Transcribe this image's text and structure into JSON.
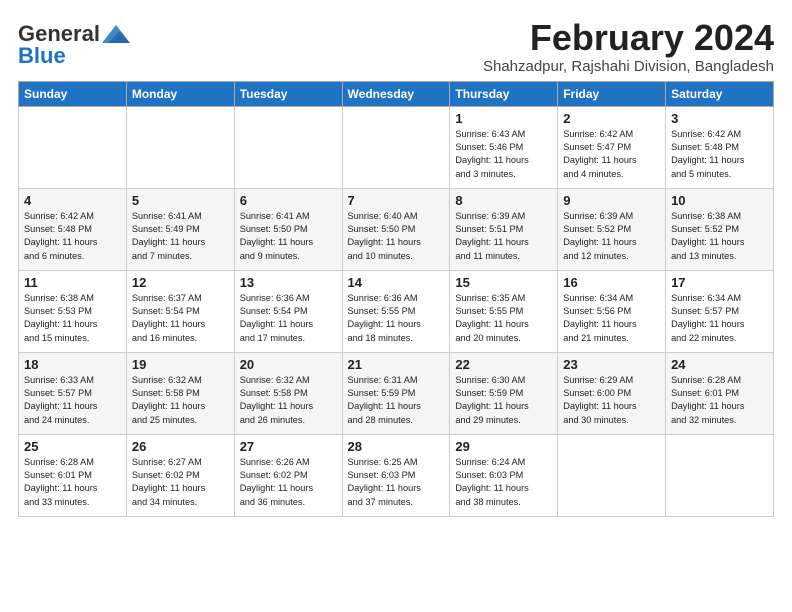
{
  "logo": {
    "line1": "General",
    "line2": "Blue"
  },
  "title": "February 2024",
  "location": "Shahzadpur, Rajshahi Division, Bangladesh",
  "weekdays": [
    "Sunday",
    "Monday",
    "Tuesday",
    "Wednesday",
    "Thursday",
    "Friday",
    "Saturday"
  ],
  "weeks": [
    [
      {
        "day": "",
        "info": ""
      },
      {
        "day": "",
        "info": ""
      },
      {
        "day": "",
        "info": ""
      },
      {
        "day": "",
        "info": ""
      },
      {
        "day": "1",
        "info": "Sunrise: 6:43 AM\nSunset: 5:46 PM\nDaylight: 11 hours\nand 3 minutes."
      },
      {
        "day": "2",
        "info": "Sunrise: 6:42 AM\nSunset: 5:47 PM\nDaylight: 11 hours\nand 4 minutes."
      },
      {
        "day": "3",
        "info": "Sunrise: 6:42 AM\nSunset: 5:48 PM\nDaylight: 11 hours\nand 5 minutes."
      }
    ],
    [
      {
        "day": "4",
        "info": "Sunrise: 6:42 AM\nSunset: 5:48 PM\nDaylight: 11 hours\nand 6 minutes."
      },
      {
        "day": "5",
        "info": "Sunrise: 6:41 AM\nSunset: 5:49 PM\nDaylight: 11 hours\nand 7 minutes."
      },
      {
        "day": "6",
        "info": "Sunrise: 6:41 AM\nSunset: 5:50 PM\nDaylight: 11 hours\nand 9 minutes."
      },
      {
        "day": "7",
        "info": "Sunrise: 6:40 AM\nSunset: 5:50 PM\nDaylight: 11 hours\nand 10 minutes."
      },
      {
        "day": "8",
        "info": "Sunrise: 6:39 AM\nSunset: 5:51 PM\nDaylight: 11 hours\nand 11 minutes."
      },
      {
        "day": "9",
        "info": "Sunrise: 6:39 AM\nSunset: 5:52 PM\nDaylight: 11 hours\nand 12 minutes."
      },
      {
        "day": "10",
        "info": "Sunrise: 6:38 AM\nSunset: 5:52 PM\nDaylight: 11 hours\nand 13 minutes."
      }
    ],
    [
      {
        "day": "11",
        "info": "Sunrise: 6:38 AM\nSunset: 5:53 PM\nDaylight: 11 hours\nand 15 minutes."
      },
      {
        "day": "12",
        "info": "Sunrise: 6:37 AM\nSunset: 5:54 PM\nDaylight: 11 hours\nand 16 minutes."
      },
      {
        "day": "13",
        "info": "Sunrise: 6:36 AM\nSunset: 5:54 PM\nDaylight: 11 hours\nand 17 minutes."
      },
      {
        "day": "14",
        "info": "Sunrise: 6:36 AM\nSunset: 5:55 PM\nDaylight: 11 hours\nand 18 minutes."
      },
      {
        "day": "15",
        "info": "Sunrise: 6:35 AM\nSunset: 5:55 PM\nDaylight: 11 hours\nand 20 minutes."
      },
      {
        "day": "16",
        "info": "Sunrise: 6:34 AM\nSunset: 5:56 PM\nDaylight: 11 hours\nand 21 minutes."
      },
      {
        "day": "17",
        "info": "Sunrise: 6:34 AM\nSunset: 5:57 PM\nDaylight: 11 hours\nand 22 minutes."
      }
    ],
    [
      {
        "day": "18",
        "info": "Sunrise: 6:33 AM\nSunset: 5:57 PM\nDaylight: 11 hours\nand 24 minutes."
      },
      {
        "day": "19",
        "info": "Sunrise: 6:32 AM\nSunset: 5:58 PM\nDaylight: 11 hours\nand 25 minutes."
      },
      {
        "day": "20",
        "info": "Sunrise: 6:32 AM\nSunset: 5:58 PM\nDaylight: 11 hours\nand 26 minutes."
      },
      {
        "day": "21",
        "info": "Sunrise: 6:31 AM\nSunset: 5:59 PM\nDaylight: 11 hours\nand 28 minutes."
      },
      {
        "day": "22",
        "info": "Sunrise: 6:30 AM\nSunset: 5:59 PM\nDaylight: 11 hours\nand 29 minutes."
      },
      {
        "day": "23",
        "info": "Sunrise: 6:29 AM\nSunset: 6:00 PM\nDaylight: 11 hours\nand 30 minutes."
      },
      {
        "day": "24",
        "info": "Sunrise: 6:28 AM\nSunset: 6:01 PM\nDaylight: 11 hours\nand 32 minutes."
      }
    ],
    [
      {
        "day": "25",
        "info": "Sunrise: 6:28 AM\nSunset: 6:01 PM\nDaylight: 11 hours\nand 33 minutes."
      },
      {
        "day": "26",
        "info": "Sunrise: 6:27 AM\nSunset: 6:02 PM\nDaylight: 11 hours\nand 34 minutes."
      },
      {
        "day": "27",
        "info": "Sunrise: 6:26 AM\nSunset: 6:02 PM\nDaylight: 11 hours\nand 36 minutes."
      },
      {
        "day": "28",
        "info": "Sunrise: 6:25 AM\nSunset: 6:03 PM\nDaylight: 11 hours\nand 37 minutes."
      },
      {
        "day": "29",
        "info": "Sunrise: 6:24 AM\nSunset: 6:03 PM\nDaylight: 11 hours\nand 38 minutes."
      },
      {
        "day": "",
        "info": ""
      },
      {
        "day": "",
        "info": ""
      }
    ]
  ]
}
